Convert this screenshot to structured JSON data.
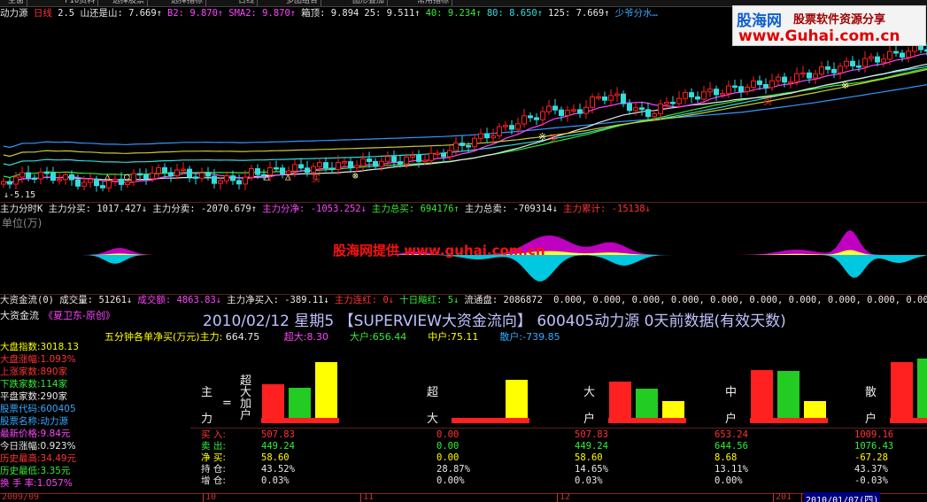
{
  "toolbar": {
    "tabs": [
      "主窗",
      "F10资料",
      "选择股票",
      "选择指标",
      "日线",
      "多图组合",
      "图形叠加",
      "常用指标"
    ]
  },
  "kline_header": {
    "name": "动力源",
    "period": "日线",
    "num": "2.5",
    "items": [
      {
        "label": "山还是山:",
        "value": "7.669",
        "arrow": "↑",
        "color": "#e8e8e8"
      },
      {
        "label": "B2:",
        "value": "9.870",
        "arrow": "↑",
        "color": "#ff44ff"
      },
      {
        "label": "SMA2:",
        "value": "9.870",
        "arrow": "↑",
        "color": "#ff44ff"
      },
      {
        "label": "箱顶:",
        "value": "9.894",
        "arrow": "",
        "color": "#e8e8e8"
      },
      {
        "label": "25:",
        "value": "9.511",
        "arrow": "↑",
        "color": "#e8e8e8"
      },
      {
        "label": "40:",
        "value": "9.234",
        "arrow": "↑",
        "color": "#33ee33"
      },
      {
        "label": "80:",
        "value": "8.650",
        "arrow": "↑",
        "color": "#33dddd"
      },
      {
        "label": "125:",
        "value": "7.669",
        "arrow": "↑",
        "color": "#e8e8e8"
      },
      {
        "label": "少爷分水…",
        "value": "",
        "arrow": "",
        "color": "#33aaff"
      }
    ],
    "low_price": "5.15"
  },
  "banner": {
    "brand": "股海网",
    "tagline": "股票软件资源分享",
    "url": "www.Guhai.com.cn"
  },
  "flow_header": {
    "title": "主力分时K",
    "items": [
      {
        "label": "主力分买:",
        "value": "1017.427",
        "arrow": "↓",
        "color": "#e8e8e8"
      },
      {
        "label": "主力分卖:",
        "value": "-2070.679",
        "arrow": "↑",
        "color": "#e8e8e8"
      },
      {
        "label": "主力分净:",
        "value": "-1053.252",
        "arrow": "↓",
        "color": "#ff44ff"
      },
      {
        "label": "主力总买:",
        "value": "694176",
        "arrow": "↑",
        "color": "#33ee33"
      },
      {
        "label": "主力总卖:",
        "value": "-709314",
        "arrow": "↓",
        "color": "#e8e8e8"
      },
      {
        "label": "主力累计:",
        "value": "-15138",
        "arrow": "↓",
        "color": "#ff3333"
      }
    ],
    "unit": "单位(万)",
    "watermark": "股海网提供 www.guhai.com.cn"
  },
  "money_header": {
    "title": "大资金流(0)",
    "items": [
      {
        "label": "成交量:",
        "value": "51261",
        "arrow": "↓",
        "color": "#e8e8e8"
      },
      {
        "label": "成交额:",
        "value": "4863.83",
        "arrow": "↓",
        "color": "#ff44ff"
      },
      {
        "label": "主力净买入:",
        "value": "-389.11",
        "arrow": "↓",
        "color": "#e8e8e8"
      },
      {
        "label": "主力连红:",
        "value": "0",
        "arrow": "↓",
        "color": "#ff3333"
      },
      {
        "label": "十日飚红:",
        "value": "5",
        "arrow": "↓",
        "color": "#33ee33"
      },
      {
        "label": "流通盘:",
        "value": "2086872",
        "arrow": "",
        "color": "#e8e8e8"
      }
    ],
    "zeros": "0.000, 0.000, 0.000, 0.000, 0.000, 0.000, 0.000, 0.000, 0.000, 0.000,"
  },
  "panel": {
    "name": "大资金流",
    "author": "《夏卫东-原创》",
    "date": "2010/02/12",
    "weekday": "星期5",
    "title": "【SUPERVIEW大资金流向】",
    "stock": "600405动力源",
    "note": "0天前数据(有效天数)"
  },
  "summary_line": {
    "label": "五分钟各单净买(万元)主力:",
    "main": "664.75",
    "items": [
      {
        "label": "超大:",
        "value": "8.30",
        "color": "#ff44ff"
      },
      {
        "label": "大户:",
        "value": "656.44",
        "color": "#33ee33"
      },
      {
        "label": "中户:",
        "value": "75.11",
        "color": "#ffff00"
      },
      {
        "label": "散户:",
        "value": "-739.85",
        "color": "#33aaff"
      }
    ]
  },
  "sidebar": [
    {
      "label": "大盘指数:",
      "value": "3018.13",
      "color": "#ffff00"
    },
    {
      "label": "大盘涨幅:",
      "value": "1.093%",
      "color": "#ff3333"
    },
    {
      "label": "上涨家数:",
      "value": "890家",
      "color": "#ff3333"
    },
    {
      "label": "下跌家数:",
      "value": "114家",
      "color": "#33ee33"
    },
    {
      "label": "平盘家数:",
      "value": "290家",
      "color": "#e8e8e8"
    },
    {
      "label": "股票代码:",
      "value": "600405",
      "color": "#33aaff"
    },
    {
      "label": "股票名称:",
      "value": "动力源",
      "color": "#33aaff"
    },
    {
      "label": "最新价格:",
      "value": "9.84元",
      "color": "#ff44ff"
    },
    {
      "label": "今日涨幅:",
      "value": "0.923%",
      "color": "#e8e8e8"
    },
    {
      "label": "历史最高:",
      "value": "34.49元",
      "color": "#ff3333"
    },
    {
      "label": "历史最低:",
      "value": "3.35元",
      "color": "#33ee33"
    },
    {
      "label": "换 手 率:",
      "value": "1.057%",
      "color": "#ff44ff"
    }
  ],
  "groups": [
    {
      "key": "main",
      "label_top": "主",
      "label_mid": "=",
      "label_bottom": "力",
      "vertical": "超大加户",
      "bars": [
        0.63,
        0.58,
        1.0
      ],
      "bars_note": "relative bar heights"
    },
    {
      "key": "super",
      "label_top": "超",
      "label_bottom": "大",
      "bars": [
        0,
        0,
        0.71
      ]
    },
    {
      "key": "big",
      "label_top": "大",
      "label_bottom": "户",
      "bars": [
        0.68,
        0.56,
        0.36
      ]
    },
    {
      "key": "mid",
      "label_top": "中",
      "label_bottom": "户",
      "bars": [
        0.87,
        0.86,
        0.36
      ]
    },
    {
      "key": "retail",
      "label_top": "散",
      "label_bottom": "户",
      "bars": [
        1.0,
        1.06,
        0.85
      ]
    }
  ],
  "stats_labels": [
    "买 入:",
    "卖 出:",
    "净 买:",
    "持 仓:",
    "增 仓:"
  ],
  "stats": [
    [
      "507.83",
      "449.24",
      "58.60",
      "43.52%",
      "0.03%"
    ],
    [
      "0.00",
      "0.00",
      "0.00",
      "28.87%",
      "0.00%"
    ],
    [
      "507.83",
      "449.24",
      "58.60",
      "14.65%",
      "0.03%"
    ],
    [
      "653.24",
      "644.56",
      "8.68",
      "13.11%",
      "0.00%"
    ],
    [
      "1009.16",
      "1076.43",
      "-67.28",
      "43.37%",
      "-0.03%"
    ]
  ],
  "axis": {
    "labels": [
      "2009/09",
      "10",
      "11",
      "12",
      "201",
      "2010/01/07(四)"
    ]
  },
  "colors": {
    "up": "#ff2020",
    "down": "#33dddd",
    "ma_white": "#e8e8e8",
    "ma_magenta": "#ff44ff",
    "buy": "#ff2020",
    "sell": "#22cc22",
    "net": "#ffff00"
  }
}
